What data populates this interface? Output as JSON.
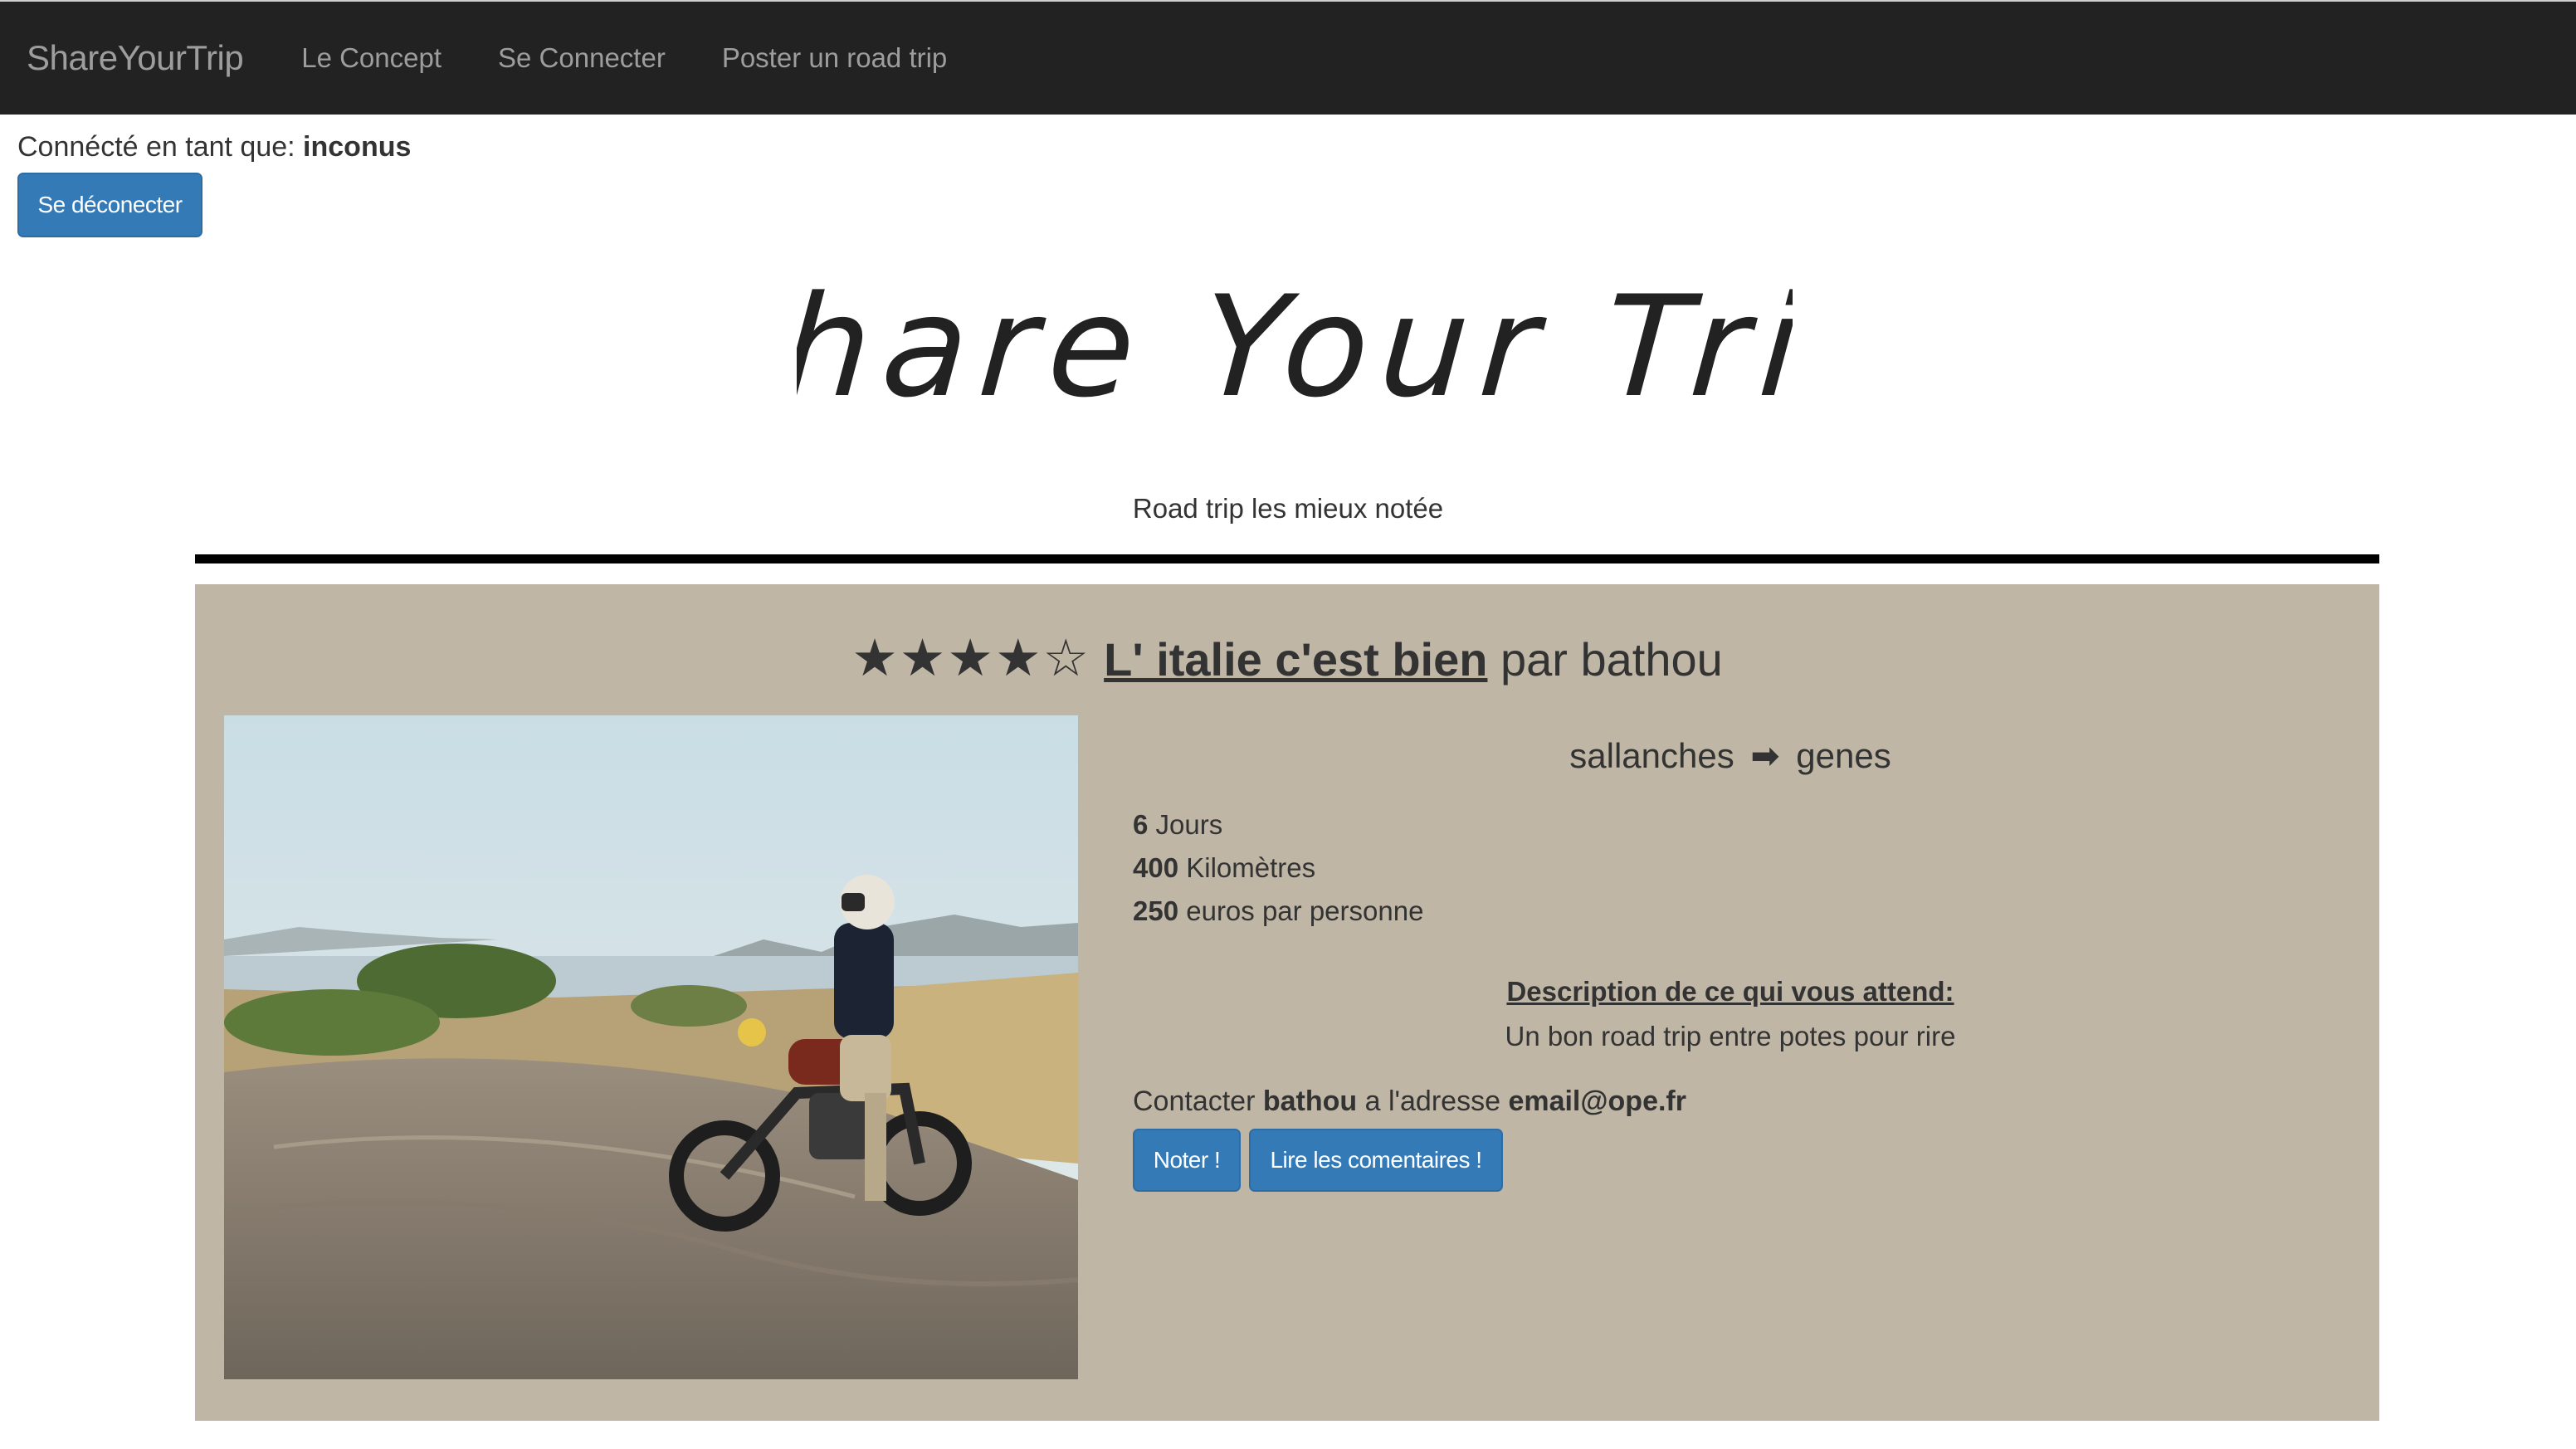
{
  "navbar": {
    "brand": "ShareYourTrip",
    "links": [
      "Le Concept",
      "Se Connecter",
      "Poster un road trip"
    ]
  },
  "session": {
    "label": "Connécté en tant que:",
    "username": "inconus",
    "logout_label": "Se déconecter"
  },
  "hero": {
    "logo_text": "Share Your Trip",
    "subtitle": "Road trip les mieux notée"
  },
  "trip": {
    "rating": 4,
    "rating_max": 5,
    "stars": "★★★★☆",
    "title": "L' italie c'est bien",
    "by_label": "par",
    "author": "bathou",
    "from": "sallanches",
    "to": "genes",
    "arrow_icon": "arrow-right-icon",
    "days_value": "6",
    "days_label": "Jours",
    "km_value": "400",
    "km_label": "Kilomètres",
    "price_value": "250",
    "price_label": "euros par personne",
    "description_title": "Description de ce qui vous attend:",
    "description": "Un bon road trip entre potes pour rire",
    "contact_prefix": "Contacter",
    "contact_name": "bathou",
    "contact_middle": "a l'adresse",
    "contact_email": "email@ope.fr",
    "rate_label": "Noter !",
    "comments_label": "Lire les comentaires !"
  },
  "colors": {
    "navbar_bg": "#222222",
    "nav_text": "#9d9d9d",
    "button_bg": "#337ab7",
    "card_bg": "#bfb6a5",
    "divider": "#000000"
  }
}
